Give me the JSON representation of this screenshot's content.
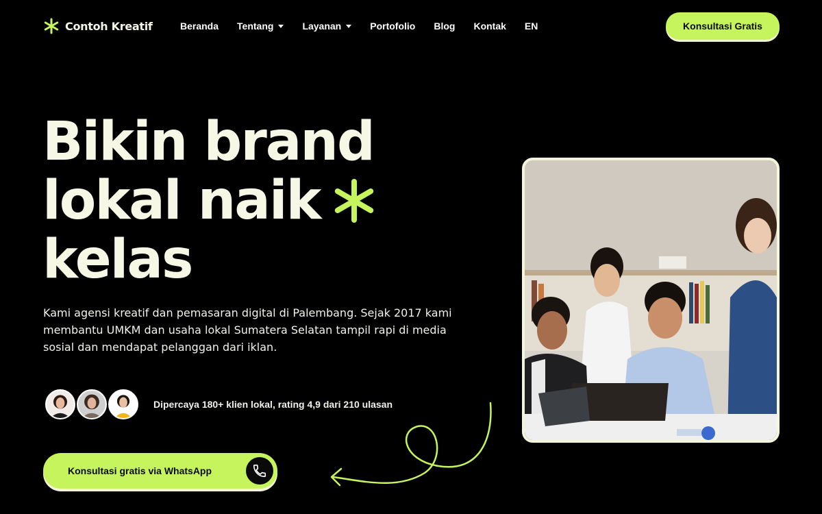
{
  "brand": {
    "name": "Contoh Kreatif",
    "accent": "#c5f45c",
    "background": "#000000",
    "text": "#f7f7e6"
  },
  "nav": {
    "items": [
      {
        "label": "Beranda",
        "dropdown": false
      },
      {
        "label": "Tentang",
        "dropdown": true
      },
      {
        "label": "Layanan",
        "dropdown": true
      },
      {
        "label": "Portofolio",
        "dropdown": false
      },
      {
        "label": "Blog",
        "dropdown": false
      },
      {
        "label": "Kontak",
        "dropdown": false
      },
      {
        "label": "EN",
        "dropdown": false
      }
    ],
    "cta": "Konsultasi Gratis"
  },
  "hero": {
    "headline": [
      "Bikin brand",
      "lokal naik",
      "kelas"
    ],
    "headline_icon": "asterisk-icon",
    "description": "Kami agensi kreatif dan pemasaran digital di Palembang. Sejak 2017 kami membantu UMKM dan usaha lokal Sumatera Selatan tampil rapi di media sosial dan mendapat pelanggan dari iklan.",
    "trust_text": "Dipercaya 180+ klien lokal, rating 4,9 dari 210 ulasan",
    "cta_label": "Konsultasi gratis via WhatsApp",
    "cta_icon": "phone-icon"
  }
}
